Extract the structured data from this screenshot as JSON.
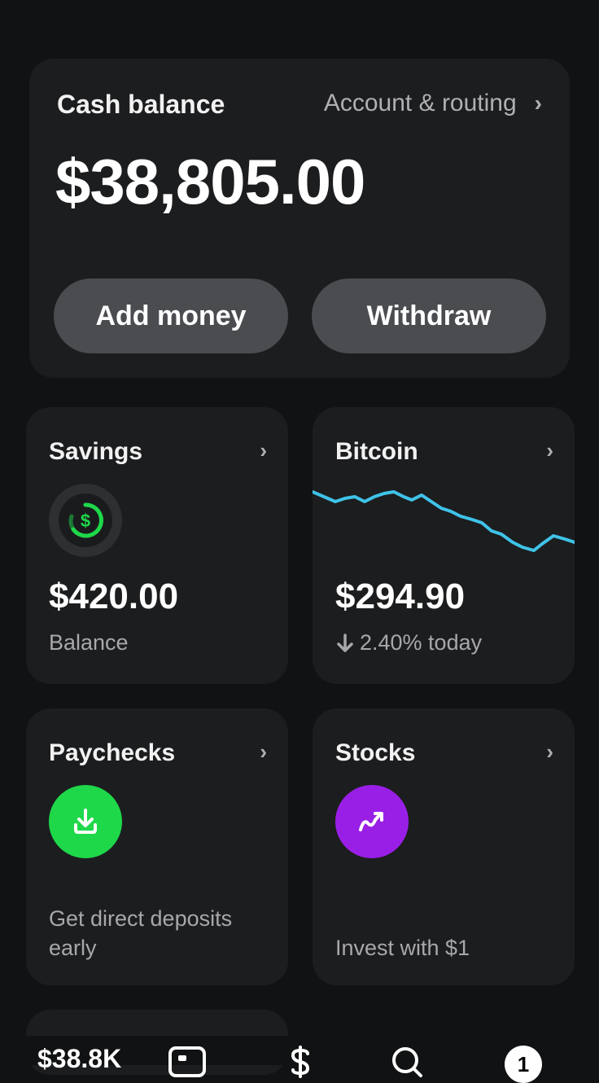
{
  "cash": {
    "title": "Cash balance",
    "account_link": "Account & routing",
    "balance": "$38,805.00",
    "add_money_label": "Add money",
    "withdraw_label": "Withdraw"
  },
  "tiles": {
    "savings": {
      "title": "Savings",
      "value": "$420.00",
      "sub": "Balance",
      "icon": "dollar-circle-icon"
    },
    "bitcoin": {
      "title": "Bitcoin",
      "value": "$294.90",
      "change": "2.40% today",
      "change_icon": "arrow-down-icon",
      "line_color": "#3fc3e8"
    },
    "paychecks": {
      "title": "Paychecks",
      "desc_line1": "Get direct deposits",
      "desc_line2": "early",
      "icon": "download-icon",
      "icon_color": "#1ed84a"
    },
    "stocks": {
      "title": "Stocks",
      "desc": "Invest with $1",
      "icon": "trend-up-icon",
      "icon_color": "#9a1fe6"
    }
  },
  "nav": {
    "balance": "$38.8K",
    "badge_count": "1",
    "icons": [
      "card-icon",
      "dollar-icon",
      "search-icon",
      "activity-icon"
    ]
  },
  "colors": {
    "background": "#111213",
    "card": "#1c1d1f",
    "button": "#4a4c50",
    "accent_green": "#1ed84a",
    "accent_purple": "#9a1fe6",
    "bitcoin_line": "#3fc3e8"
  }
}
